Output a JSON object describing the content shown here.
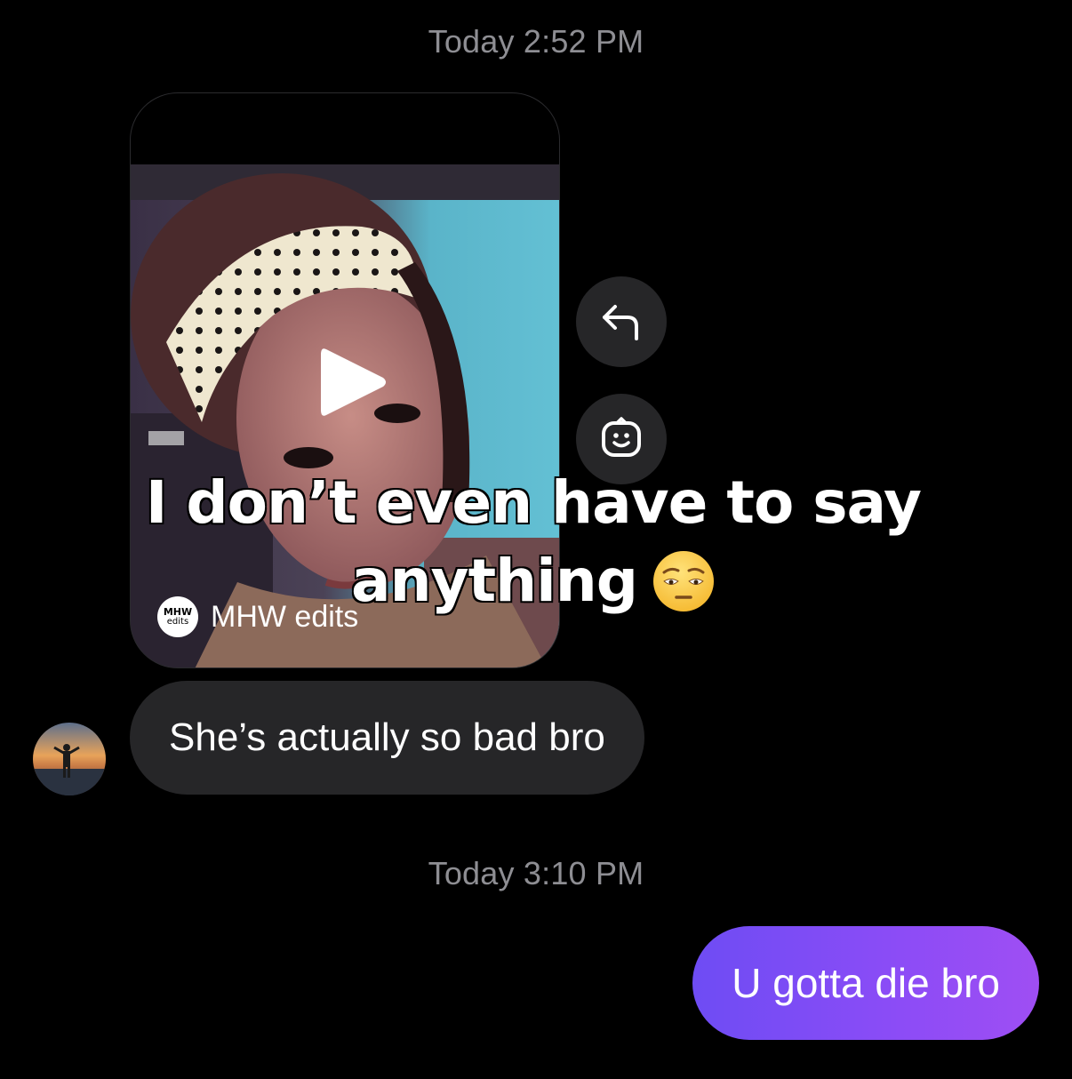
{
  "thread": {
    "timestamp_1": "Today 2:52 PM",
    "timestamp_2": "Today 3:10 PM"
  },
  "shared_reel": {
    "source_avatar_text_top": "MHW",
    "source_avatar_text_bottom": "edits",
    "source_name": "MHW edits",
    "overlay_caption_line1": "I don’t even have to say",
    "overlay_caption_line2": "anything",
    "overlay_emoji": "pensive-face"
  },
  "actions": {
    "reply_icon": "reply-arrow-icon",
    "react_icon": "emoji-react-icon"
  },
  "messages": [
    {
      "direction": "incoming",
      "text": "She’s actually so bad bro"
    },
    {
      "direction": "outgoing",
      "text": "U gotta die bro"
    }
  ],
  "colors": {
    "background": "#000000",
    "incoming_bubble": "#262628",
    "outgoing_gradient_start": "#6e4cf4",
    "outgoing_gradient_end": "#9f4ef3",
    "timestamp": "#8e8e93"
  }
}
